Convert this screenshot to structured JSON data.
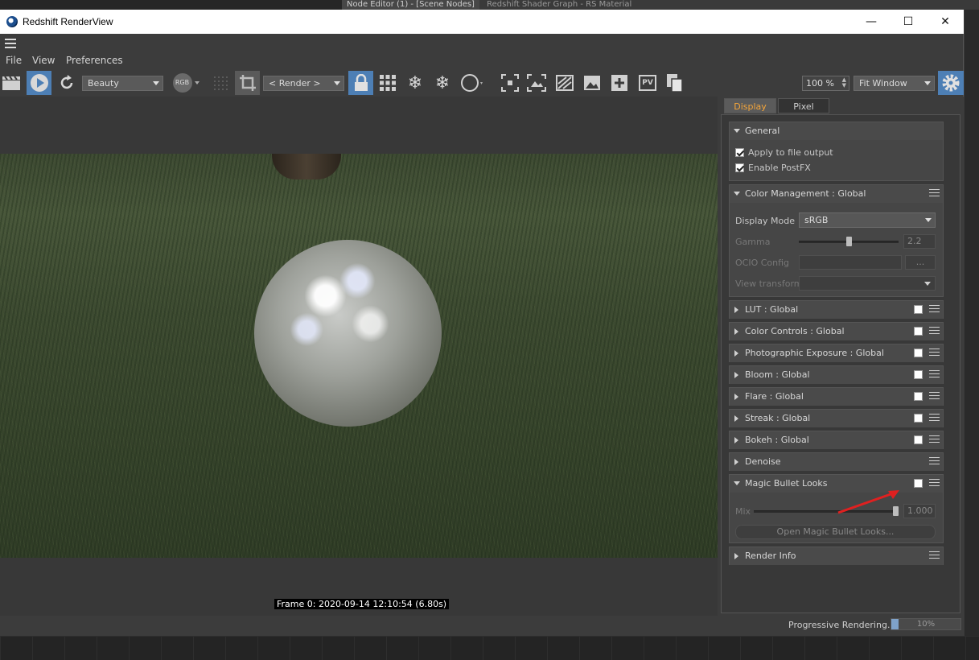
{
  "background": {
    "tabs": [
      "Node Editor (1) - [Scene Nodes]",
      "Redshift Shader Graph - RS Material"
    ]
  },
  "window": {
    "title": "Redshift RenderView",
    "minimize": "—",
    "maximize": "☐",
    "close": "✕"
  },
  "menu": {
    "file": "File",
    "view": "View",
    "preferences": "Preferences"
  },
  "toolbar": {
    "aov_select": "Beauty",
    "channel": "RGB",
    "render_select": "< Render >",
    "zoom": "100 %",
    "fit_select": "Fit Window",
    "icon_pv": "PV"
  },
  "viewport": {
    "frame_label": "Frame  0:  2020-09-14  12:10:54  (6.80s)"
  },
  "panel": {
    "tabs": {
      "display": "Display",
      "pixel": "Pixel"
    },
    "general": {
      "title": "General",
      "apply_to_file_output": "Apply to file output",
      "apply_to_file_output_checked": true,
      "enable_postfx": "Enable PostFX",
      "enable_postfx_checked": true
    },
    "color_management": {
      "title": "Color Management  : Global",
      "display_mode_label": "Display Mode",
      "display_mode_value": "sRGB",
      "gamma_label": "Gamma",
      "gamma_value": "2.2",
      "gamma_fraction": 0.5,
      "ocio_label": "OCIO Config",
      "ocio_browse": "...",
      "view_transform_label": "View transform"
    },
    "sections": [
      {
        "title": "LUT  : Global"
      },
      {
        "title": "Color Controls  : Global"
      },
      {
        "title": "Photographic Exposure  : Global"
      },
      {
        "title": "Bloom  : Global"
      },
      {
        "title": "Flare  : Global"
      },
      {
        "title": "Streak  : Global"
      },
      {
        "title": "Bokeh  : Global"
      },
      {
        "title": "Denoise"
      }
    ],
    "magic_bullet": {
      "title": "Magic Bullet Looks",
      "mix_label": "Mix",
      "mix_value": "1.000",
      "mix_fraction": 1.0,
      "open_button": "Open Magic Bullet Looks..."
    },
    "render_info": {
      "title": "Render Info"
    }
  },
  "status": {
    "label": "Progressive Rendering...",
    "progress_pct": "10%",
    "progress_fraction": 0.1
  },
  "colors": {
    "accent_blue": "#4d7fb5",
    "tab_active_text": "#f4a53a",
    "annotation_arrow": "#e02020"
  }
}
